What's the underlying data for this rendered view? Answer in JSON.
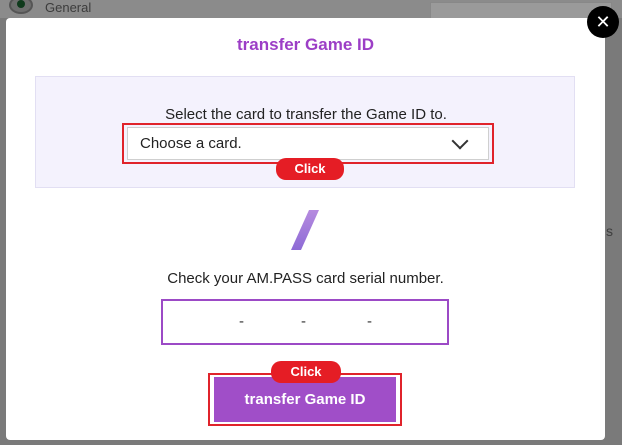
{
  "background": {
    "general_label": "General",
    "side_text": "s"
  },
  "dialog": {
    "title": "transfer Game ID",
    "select_instruction": "Select the card to transfer the Game ID to.",
    "select_value": "Choose a card.",
    "serial_label": "Check your AM.PASS card serial number.",
    "serial_dashes": [
      "-",
      "-",
      "-"
    ],
    "submit_label": "transfer Game ID",
    "close_symbol": "✕"
  },
  "annotations": {
    "click_label_1": "Click",
    "click_label_2": "Click"
  },
  "colors": {
    "accent": "#9c3ec6",
    "button": "#a04ec8",
    "highlight": "#e0232b",
    "panel": "#f4f2fd"
  },
  "icons": {
    "close": "close-icon",
    "dropdown": "chevron-down-icon",
    "divider": "slash-icon"
  }
}
